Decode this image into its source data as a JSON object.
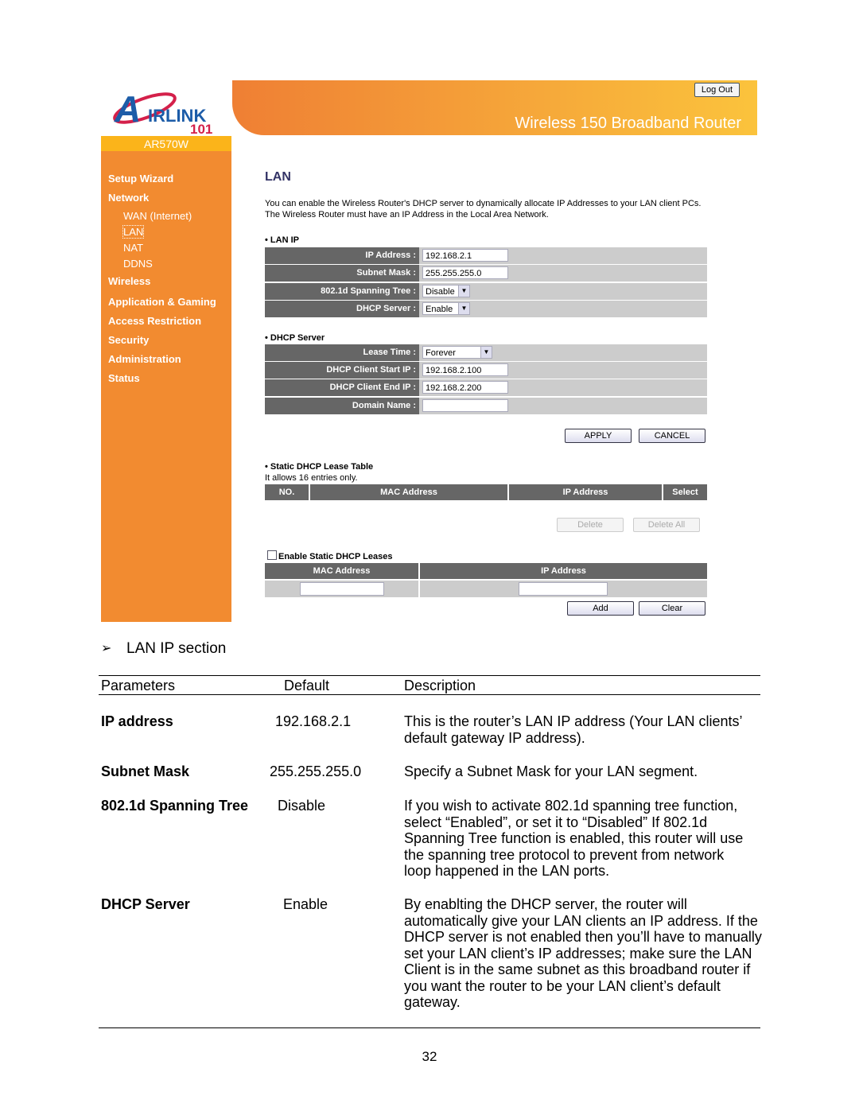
{
  "router": {
    "logo_text": "AirLink 101",
    "model": "AR570W",
    "product": "Wireless 150 Broadband Router",
    "logout": "Log Out",
    "nav": [
      {
        "label": "Setup Wizard"
      },
      {
        "label": "Network"
      },
      {
        "label": "WAN (Internet)"
      },
      {
        "label": "LAN"
      },
      {
        "label": "NAT"
      },
      {
        "label": "DDNS"
      },
      {
        "label": "Wireless"
      },
      {
        "label": "Application & Gaming"
      },
      {
        "label": "Access Restriction"
      },
      {
        "label": "Security"
      },
      {
        "label": "Administration"
      },
      {
        "label": "Status"
      }
    ],
    "title": "LAN",
    "intro1": "You can enable the Wireless Router's DHCP server to dynamically allocate IP Addresses to your LAN client PCs.",
    "intro2": "The Wireless Router must have an IP Address in the Local Area Network.",
    "lan_ip": {
      "heading": "LAN IP",
      "rows": [
        {
          "label": "IP Address :",
          "value": "192.168.2.1"
        },
        {
          "label": "Subnet Mask :",
          "value": "255.255.255.0"
        },
        {
          "label": "802.1d Spanning Tree :",
          "value": "Disable"
        },
        {
          "label": "DHCP Server :",
          "value": "Enable"
        }
      ]
    },
    "dhcp": {
      "heading": "DHCP Server",
      "rows": [
        {
          "label": "Lease Time :",
          "value": "Forever"
        },
        {
          "label": "DHCP Client Start IP :",
          "value": "192.168.2.100"
        },
        {
          "label": "DHCP Client End IP :",
          "value": "192.168.2.200"
        },
        {
          "label": "Domain Name :",
          "value": ""
        }
      ]
    },
    "apply": "APPLY",
    "cancel": "CANCEL",
    "static": {
      "heading": "Static DHCP Lease Table",
      "note": "It allows 16 entries only.",
      "cols": [
        "NO.",
        "MAC Address",
        "IP Address",
        "Select"
      ],
      "delete": "Delete",
      "delete_all": "Delete All"
    },
    "enable_static": {
      "label": "Enable Static DHCP Leases",
      "checked": false,
      "cols": [
        "MAC Address",
        "IP Address"
      ],
      "add": "Add",
      "clear": "Clear"
    }
  },
  "doc": {
    "section": "LAN IP section",
    "headers": [
      "Parameters",
      "Default",
      "Description"
    ],
    "rows": [
      {
        "param": "IP address",
        "default": "192.168.2.1",
        "desc": "This is the router’s LAN IP address (Your LAN clients’ default gateway IP address)."
      },
      {
        "param": "Subnet Mask",
        "default": "255.255.255.0",
        "desc": "Specify a Subnet Mask for your LAN segment."
      },
      {
        "param": "802.1d Spanning Tree",
        "default": "Disable",
        "desc": "If you wish to activate 802.1d spanning tree function, select “Enabled”, or set it to “Disabled” If 802.1d Spanning Tree function is enabled, this router will use the spanning tree protocol to prevent from network loop happened in the LAN ports."
      },
      {
        "param": "DHCP Server",
        "default": "Enable",
        "desc": "By enablting the DHCP server, the router will automatically give your LAN clients an IP address. If the DHCP server is not enabled then you’ll have to manually set your LAN client’s IP addresses; make sure the LAN Client is in the same subnet as this broadband router if you want the router to be your LAN client’s default gateway."
      }
    ],
    "page_number": "32"
  }
}
